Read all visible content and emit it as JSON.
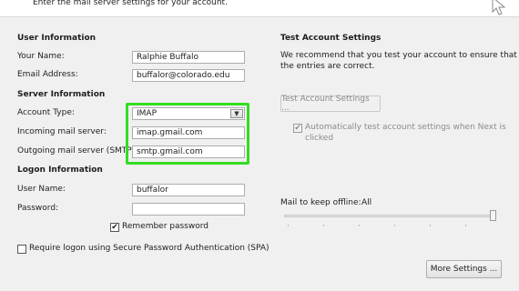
{
  "banner": {
    "text": "Enter the mail server settings for your account."
  },
  "user_info": {
    "heading": "User Information",
    "your_name_label": "Your Name:",
    "your_name_value": "Ralphie Buffalo",
    "email_label": "Email Address:",
    "email_value": "buffalor@colorado.edu"
  },
  "server_info": {
    "heading": "Server Information",
    "account_type_label": "Account Type:",
    "account_type_value": "IMAP",
    "incoming_label": "Incoming mail server:",
    "incoming_value": "imap.gmail.com",
    "outgoing_label": "Outgoing mail server (SMTP):",
    "outgoing_value": "smtp.gmail.com"
  },
  "logon_info": {
    "heading": "Logon Information",
    "user_name_label": "User Name:",
    "user_name_value": "buffalor",
    "password_label": "Password:",
    "password_value": "",
    "remember_label": "Remember password",
    "remember_checked": true,
    "spa_label": "Require logon using Secure Password Authentication (SPA)",
    "spa_checked": false
  },
  "test_settings": {
    "heading": "Test Account Settings",
    "description_line1": "We recommend that you test your account to ensure that",
    "description_line2": "the entries are correct.",
    "test_button": "Test Account Settings ...",
    "auto_test_line1": "Automatically test account settings when Next is",
    "auto_test_line2": "clicked",
    "auto_test_checked": true
  },
  "offline": {
    "label": "Mail to keep offline:",
    "value": "All"
  },
  "more_settings_button": "More Settings ...",
  "colors": {
    "highlight": "#33dd22",
    "background": "#f0f0f0"
  },
  "icons": {
    "cursor": "arrow-cursor-icon",
    "dropdown": "chevron-down-icon",
    "check": "check-icon"
  }
}
